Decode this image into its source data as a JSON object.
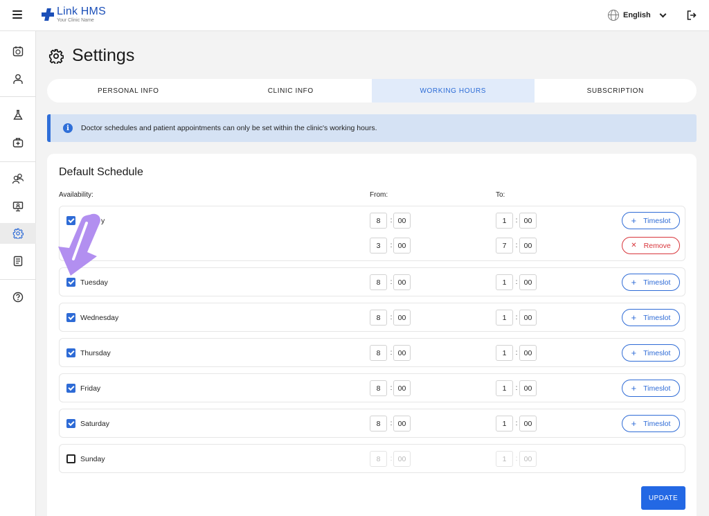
{
  "header": {
    "logo_name": "Link HMS",
    "logo_sub": "Your Clinic Name",
    "language": "English"
  },
  "sidebar": {
    "items": [
      {
        "name": "calendar-icon"
      },
      {
        "name": "user-icon"
      },
      {
        "name": "lab-flask-icon"
      },
      {
        "name": "medical-kit-icon"
      },
      {
        "name": "users-icon"
      },
      {
        "name": "monitor-icon"
      },
      {
        "name": "gear-icon",
        "active": true
      },
      {
        "name": "report-icon"
      },
      {
        "name": "help-icon"
      }
    ]
  },
  "page": {
    "title": "Settings"
  },
  "tabs": [
    {
      "label": "PERSONAL INFO",
      "active": false
    },
    {
      "label": "CLINIC INFO",
      "active": false
    },
    {
      "label": "WORKING HOURS",
      "active": true
    },
    {
      "label": "SUBSCRIPTION",
      "active": false
    }
  ],
  "alert": {
    "text": "Doctor schedules and patient appointments can only be set within the clinic's working hours."
  },
  "schedule": {
    "title": "Default Schedule",
    "col_availability": "Availability:",
    "col_from": "From:",
    "col_to": "To:",
    "days": [
      {
        "label": "Monday",
        "visible_label": "y",
        "checked": true,
        "slots": [
          {
            "from_h": "8",
            "from_m": "00",
            "to_h": "1",
            "to_m": "00",
            "action": "Timeslot"
          },
          {
            "from_h": "3",
            "from_m": "00",
            "to_h": "7",
            "to_m": "00",
            "action": "Remove"
          }
        ]
      },
      {
        "label": "Tuesday",
        "checked": true,
        "slots": [
          {
            "from_h": "8",
            "from_m": "00",
            "to_h": "1",
            "to_m": "00",
            "action": "Timeslot"
          }
        ]
      },
      {
        "label": "Wednesday",
        "checked": true,
        "slots": [
          {
            "from_h": "8",
            "from_m": "00",
            "to_h": "1",
            "to_m": "00",
            "action": "Timeslot"
          }
        ]
      },
      {
        "label": "Thursday",
        "checked": true,
        "slots": [
          {
            "from_h": "8",
            "from_m": "00",
            "to_h": "1",
            "to_m": "00",
            "action": "Timeslot"
          }
        ]
      },
      {
        "label": "Friday",
        "checked": true,
        "slots": [
          {
            "from_h": "8",
            "from_m": "00",
            "to_h": "1",
            "to_m": "00",
            "action": "Timeslot"
          }
        ]
      },
      {
        "label": "Saturday",
        "checked": true,
        "slots": [
          {
            "from_h": "8",
            "from_m": "00",
            "to_h": "1",
            "to_m": "00",
            "action": "Timeslot"
          }
        ]
      },
      {
        "label": "Sunday",
        "checked": false,
        "slots": [
          {
            "from_h": "8",
            "from_m": "00",
            "to_h": "1",
            "to_m": "00",
            "action": ""
          }
        ]
      }
    ],
    "update_label": "UPDATE"
  },
  "colors": {
    "accent": "#2e6bd6",
    "danger": "#d8353b",
    "pointer": "#b28ff0"
  }
}
